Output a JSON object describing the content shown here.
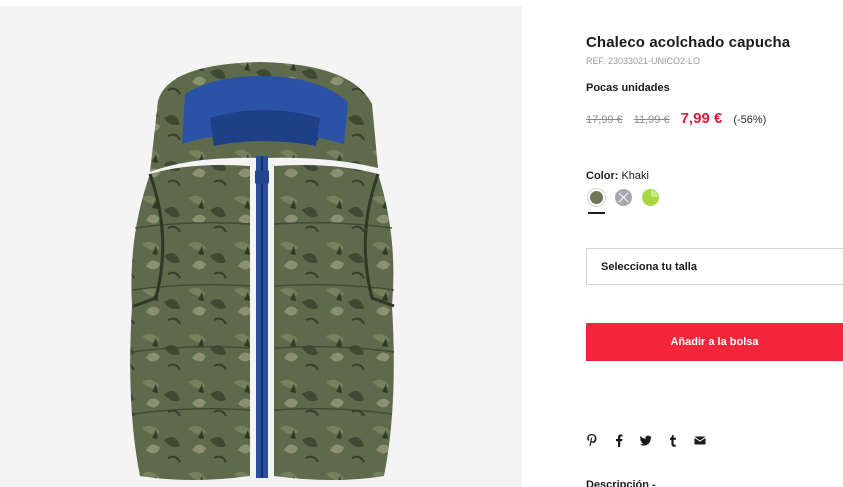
{
  "product": {
    "title": "Chaleco acolchado capucha",
    "ref": "REF. 23033021-UNICO2-LO",
    "stock_note": "Pocas unidades",
    "image_alt": "vest-photo"
  },
  "pricing": {
    "old_prices": [
      "17,99 €",
      "11,99 €"
    ],
    "current": "7,99 €",
    "discount": "(-56%)",
    "accent_color": "#e21b36"
  },
  "color": {
    "label": "Color:",
    "selected": "Khaki",
    "swatches": [
      {
        "name": "khaki",
        "hex": "#6f7556",
        "selected": true
      },
      {
        "name": "grey",
        "hex": "#a6a7af",
        "unavailable": true
      },
      {
        "name": "lime",
        "hex": "#a7d742"
      }
    ]
  },
  "size": {
    "placeholder": "Selecciona tu talla"
  },
  "actions": {
    "add_to_bag": "Añadir a la bolsa",
    "button_color": "#f3253a"
  },
  "share": {
    "icons": [
      "pinterest-icon",
      "facebook-icon",
      "twitter-icon",
      "tumblr-icon",
      "email-icon"
    ]
  },
  "description": {
    "label": "Descripción -"
  }
}
